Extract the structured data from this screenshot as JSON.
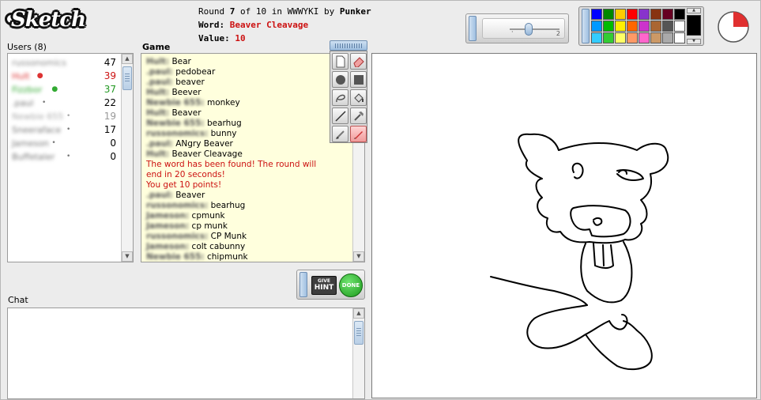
{
  "app": {
    "logo_text": "Sketch"
  },
  "round": {
    "prefix": "Round",
    "current": "7",
    "of_text": "of 10 in WWWYKI by",
    "drawer": "Punker",
    "word_label": "Word:",
    "word": "Beaver Cleavage",
    "value_label": "Value:",
    "value": "10"
  },
  "users": {
    "heading": "Users (8)",
    "list": [
      {
        "name": "russonomics",
        "score": "47",
        "color": "#888888",
        "dot": "",
        "score_color": "#000000"
      },
      {
        "name": "Hult",
        "score": "39",
        "color": "#dd3333",
        "dot": "●",
        "score_color": "#cc1111"
      },
      {
        "name": "Fizzbor",
        "score": "37",
        "color": "#33aa33",
        "dot": "●",
        "score_color": "#229922"
      },
      {
        "name": ".paul",
        "score": "22",
        "color": "#777777",
        "dot": "•",
        "score_color": "#000000"
      },
      {
        "name": "Newbie 655",
        "score": "19",
        "color": "#aaaaaa",
        "dot": "•",
        "score_color": "#999999"
      },
      {
        "name": "Sneeraface",
        "score": "17",
        "color": "#777777",
        "dot": "•",
        "score_color": "#000000"
      },
      {
        "name": "Jameson",
        "score": "0",
        "color": "#777777",
        "dot": "•",
        "score_color": "#000000"
      },
      {
        "name": "Buffetaler",
        "score": "0",
        "color": "#777777",
        "dot": "•",
        "score_color": "#000000"
      }
    ]
  },
  "game": {
    "heading": "Game",
    "lines": [
      {
        "name": "Hult:",
        "text": "Bear"
      },
      {
        "name": ".paul:",
        "text": "pedobear"
      },
      {
        "name": ".paul:",
        "text": "beaver"
      },
      {
        "name": "Hult:",
        "text": "Beever"
      },
      {
        "name": "Newbie 655:",
        "text": "monkey"
      },
      {
        "name": "Hult:",
        "text": "Beaver"
      },
      {
        "name": "Newbie 655:",
        "text": "bearhug"
      },
      {
        "name": "russonomics:",
        "text": "bunny"
      },
      {
        "name": ".paul:",
        "text": "ANgry Beaver"
      },
      {
        "name": "Hult:",
        "text": "Beaver Cleavage"
      },
      {
        "name": "",
        "text": "The word has been found! The round will",
        "system": true
      },
      {
        "name": "",
        "text": "end in 20 seconds!",
        "system": true
      },
      {
        "name": "",
        "text": "You get 10 points!",
        "system": true
      },
      {
        "name": ".paul:",
        "text": "Beaver"
      },
      {
        "name": "russonomics:",
        "text": "bearhug"
      },
      {
        "name": "Jameson:",
        "text": "cpmunk"
      },
      {
        "name": "Jameson:",
        "text": "cp munk"
      },
      {
        "name": "russonomics:",
        "text": "CP Munk"
      },
      {
        "name": "Jameson:",
        "text": "colt cabunny"
      },
      {
        "name": "Newbie 655:",
        "text": "chipmunk"
      }
    ]
  },
  "controls": {
    "hint_small": "GIVE",
    "hint_big": "HINT",
    "done_label": "DONE",
    "brush_size": "2"
  },
  "chat": {
    "heading": "Chat"
  },
  "palette": {
    "colors": [
      "#0000ff",
      "#008800",
      "#ffcc00",
      "#ff0000",
      "#8833cc",
      "#883311",
      "#660022",
      "#000000",
      "#0099ff",
      "#00bb00",
      "#ffee00",
      "#ff6600",
      "#cc33cc",
      "#aa6633",
      "#555555",
      "#ffffff",
      "#33ccff",
      "#33cc33",
      "#ffff66",
      "#ff9966",
      "#ff66cc",
      "#cc9966",
      "#aaaaaa",
      "#ffffff"
    ],
    "selected": "#000000"
  },
  "timer": {
    "elapsed_fraction": 0.25
  }
}
